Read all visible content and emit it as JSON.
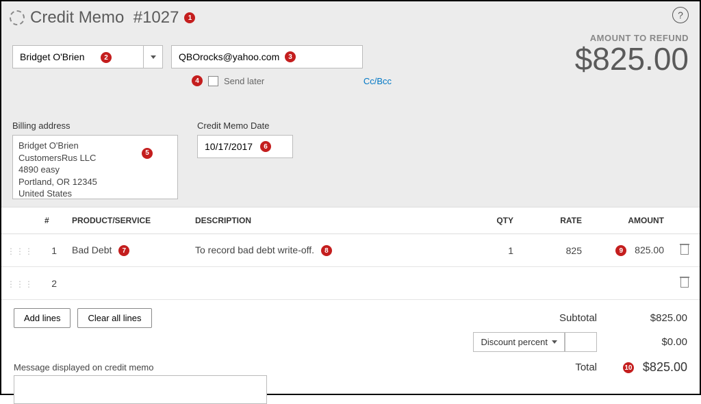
{
  "header": {
    "title_prefix": "Credit Memo",
    "doc_number": "#1027",
    "help_tooltip": "?"
  },
  "amount": {
    "label": "AMOUNT TO REFUND",
    "value": "$825.00"
  },
  "customer": {
    "name": "Bridget O'Brien",
    "email": "QBOrocks@yahoo.com",
    "send_later_label": "Send later",
    "ccbcc_label": "Cc/Bcc"
  },
  "billing": {
    "label": "Billing address",
    "lines": [
      "Bridget O'Brien",
      "CustomersRus LLC",
      "4890 easy",
      "Portland, OR  12345",
      "United States"
    ]
  },
  "date": {
    "label": "Credit Memo Date",
    "value": "10/17/2017"
  },
  "table": {
    "headers": {
      "num": "#",
      "product": "PRODUCT/SERVICE",
      "description": "DESCRIPTION",
      "qty": "QTY",
      "rate": "RATE",
      "amount": "AMOUNT"
    },
    "rows": [
      {
        "n": "1",
        "product": "Bad Debt",
        "description": "To record bad debt write-off.",
        "qty": "1",
        "rate": "825",
        "amount": "825.00"
      },
      {
        "n": "2",
        "product": "",
        "description": "",
        "qty": "",
        "rate": "",
        "amount": ""
      }
    ]
  },
  "buttons": {
    "add_lines": "Add lines",
    "clear_lines": "Clear all lines"
  },
  "totals": {
    "subtotal_label": "Subtotal",
    "subtotal_value": "$825.00",
    "discount_type": "Discount percent",
    "discount_value": "$0.00",
    "total_label": "Total",
    "total_value": "$825.00"
  },
  "message": {
    "label": "Message displayed on credit memo"
  },
  "annotations": {
    "b1": "1",
    "b2": "2",
    "b3": "3",
    "b4": "4",
    "b5": "5",
    "b6": "6",
    "b7": "7",
    "b8": "8",
    "b9": "9",
    "b10": "10"
  }
}
